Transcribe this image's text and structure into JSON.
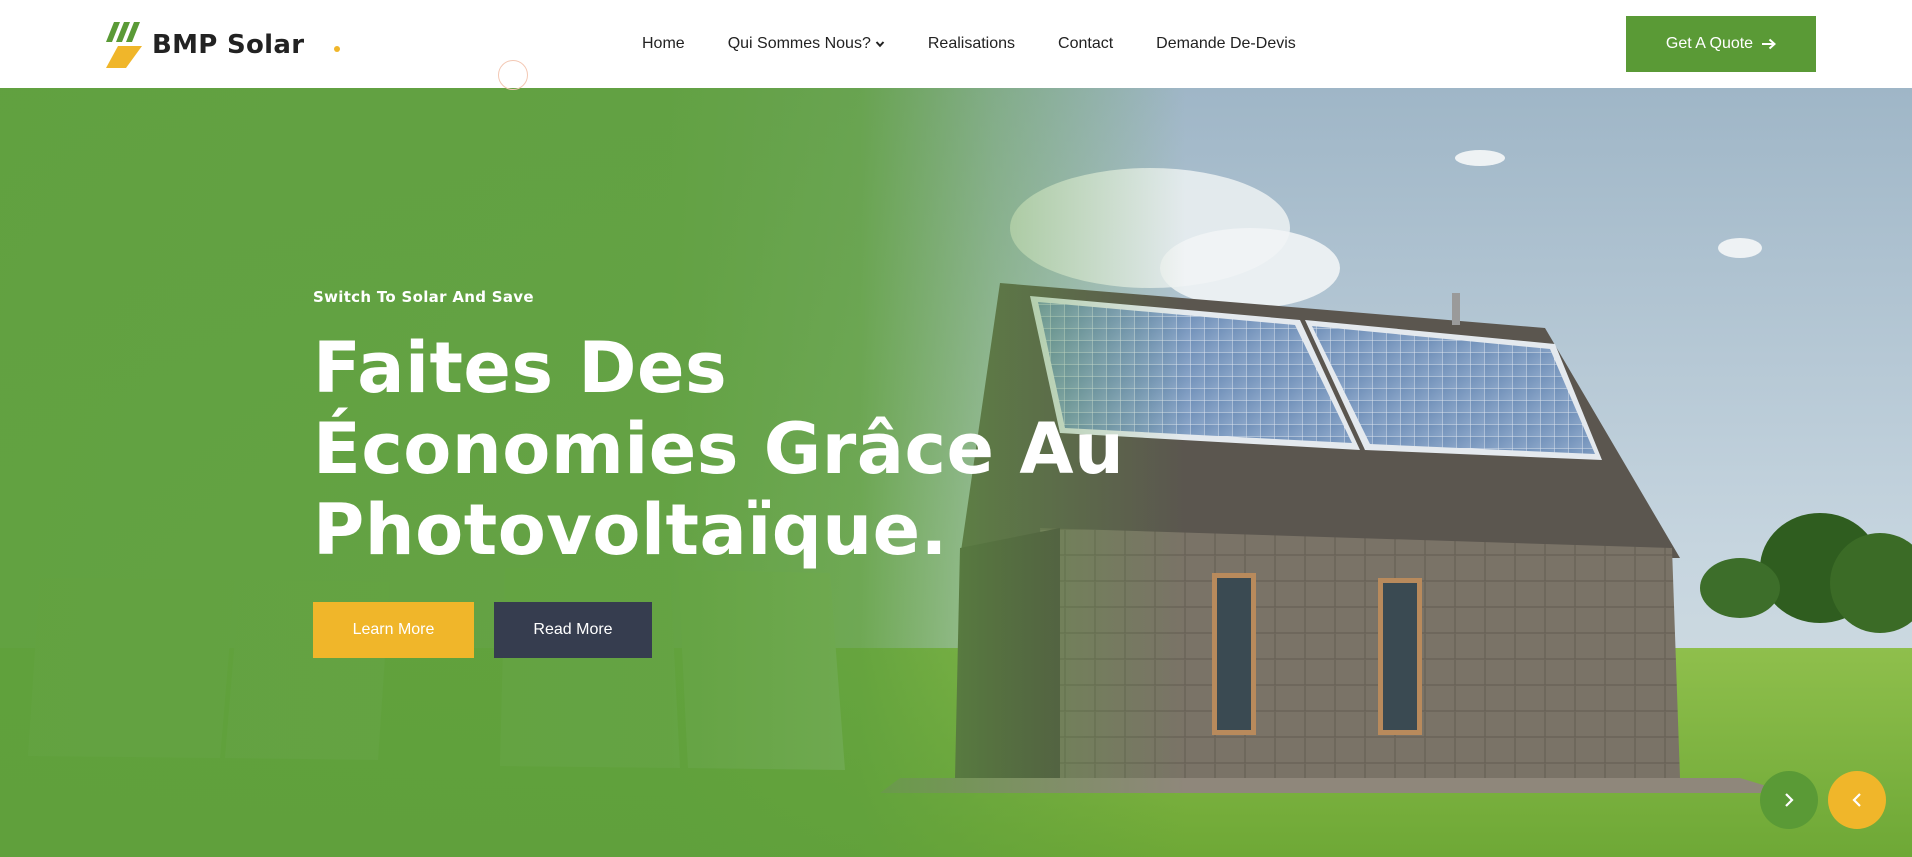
{
  "brand": {
    "name": "BMP Solar",
    "logo_icon": "solar-bolt-logo-icon"
  },
  "nav": {
    "items": [
      {
        "label": "Home"
      },
      {
        "label": "Qui Sommes Nous?",
        "has_dropdown": true
      },
      {
        "label": "Realisations"
      },
      {
        "label": "Contact"
      },
      {
        "label": "Demande De-Devis"
      }
    ]
  },
  "header": {
    "quote_button": "Get A Quote",
    "quote_icon": "arrow-right-icon"
  },
  "hero": {
    "subtitle": "Switch To Solar And Save",
    "headline_lines": [
      "Faites Des",
      "Économies Grâce Au",
      "Photovoltaïque."
    ],
    "learn_more": "Learn More",
    "read_more": "Read More",
    "next_icon": "chevron-right-icon",
    "prev_icon": "chevron-left-icon"
  },
  "colors": {
    "primary_green": "#5a9a36",
    "accent_yellow": "#f0b62a",
    "dark_button": "#363d4f",
    "text_dark": "#222222"
  }
}
